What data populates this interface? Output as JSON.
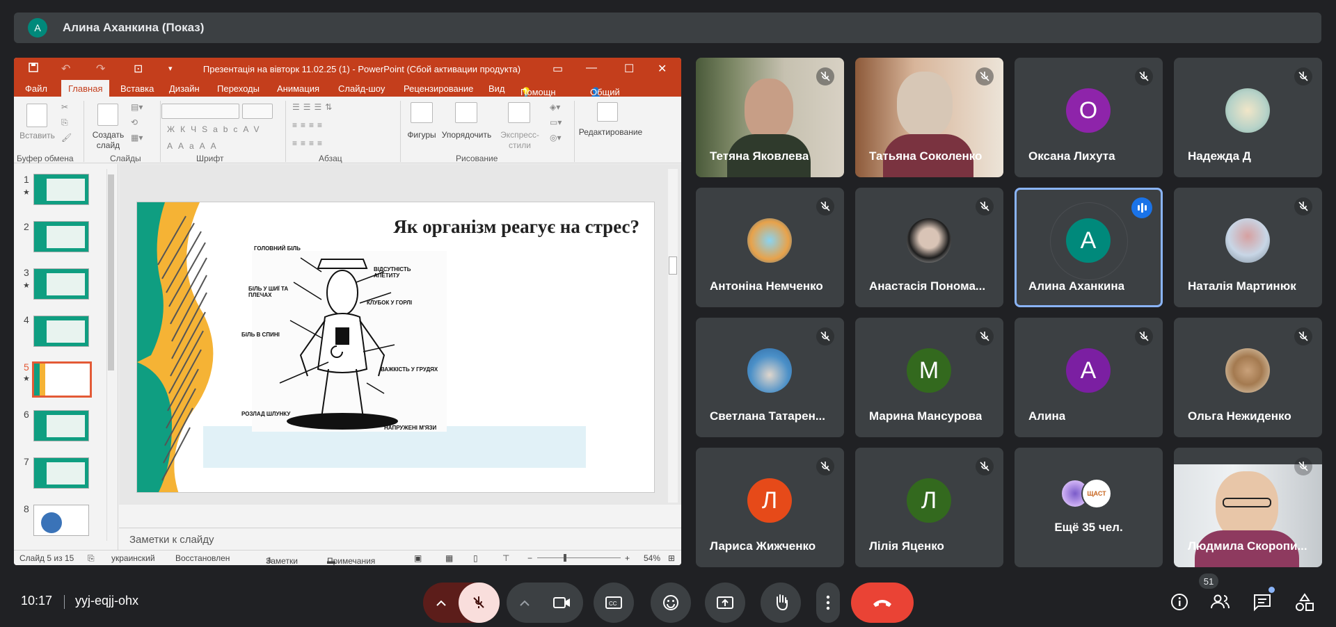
{
  "presenter": {
    "initial": "А",
    "label": "Алина Аханкина (Показ)"
  },
  "powerpoint": {
    "window_title": "Презентація на вівторк 11.02.25 (1) - PowerPoint (Сбой активации продукта)",
    "tabs": [
      "Файл",
      "Главная",
      "Вставка",
      "Дизайн",
      "Переходы",
      "Анимация",
      "Слайд-шоу",
      "Рецензирование",
      "Вид",
      "Помощн",
      "Общий доступ"
    ],
    "ribbon": {
      "paste": "Вставить",
      "new_slide": "Создать слайд",
      "shapes": "Фигуры",
      "arrange": "Упорядочить",
      "quick_styles": "Экспресс-стили",
      "editing": "Редактирование",
      "groups": [
        "Буфер обмена",
        "Слайды",
        "Шрифт",
        "Абзац",
        "Рисование"
      ]
    },
    "slide_numbers": [
      "1",
      "2",
      "3",
      "4",
      "5",
      "6",
      "7",
      "8"
    ],
    "slide_title": "Як організм реагує на стрес?",
    "slide_labels": [
      "ГОЛОВНИЙ БІЛЬ",
      "ВІДСУТНІСТЬ АПЕТИТУ",
      "БІЛЬ У ШИЇ ТА ПЛЕЧАХ",
      "КЛУБОК У ГОРЛІ",
      "БІЛЬ В СПИНІ",
      "ВАЖКІСТЬ У ГРУДЯХ",
      "РОЗЛАД ШЛУНКУ",
      "НАПРУЖЕНІ М'ЯЗИ"
    ],
    "notes_placeholder": "Заметки к слайду",
    "status": {
      "slide": "Слайд 5 из 15",
      "language": "украинский",
      "recovered": "Восстановлен",
      "notes": "Заметки",
      "comments": "Примечания",
      "zoom": "54%"
    }
  },
  "participants": [
    {
      "name": "Тетяна Яковлева",
      "type": "video"
    },
    {
      "name": "Татьяна Соколенко",
      "type": "video"
    },
    {
      "name": "Оксана Лихута",
      "initial": "О",
      "color": "#8e24aa"
    },
    {
      "name": "Надежда Д",
      "type": "photo"
    },
    {
      "name": "Антоніна Немченко",
      "type": "photo"
    },
    {
      "name": "Анастасія Понома...",
      "type": "photo"
    },
    {
      "name": "Алина Аханкина",
      "initial": "А",
      "color": "#00897b",
      "speaking": true
    },
    {
      "name": "Наталія Мартинюк",
      "type": "photo"
    },
    {
      "name": "Светлана Татарен...",
      "type": "photo"
    },
    {
      "name": "Марина Мансурова",
      "initial": "М",
      "color": "#33691e"
    },
    {
      "name": "Алина",
      "initial": "А",
      "color": "#7b1fa2"
    },
    {
      "name": "Ольга Нежиденко",
      "type": "photo"
    },
    {
      "name": "Лариса Жижченко",
      "initial": "Л",
      "color": "#e64a19"
    },
    {
      "name": "Лілія Яценко",
      "initial": "Л",
      "color": "#33691e"
    },
    {
      "name": "Ещё 35 чел.",
      "type": "more"
    },
    {
      "name": "Людмила Скоропи...",
      "type": "video"
    }
  ],
  "more_tile_badge": "ЩАСТ",
  "meeting": {
    "time": "10:17",
    "code": "yyj-eqjj-ohx",
    "participants_count": "51"
  },
  "colors": {
    "hangup": "#ea4335",
    "mic_off_bg": "#f9dedc",
    "pp_accent": "#c43e1c"
  }
}
